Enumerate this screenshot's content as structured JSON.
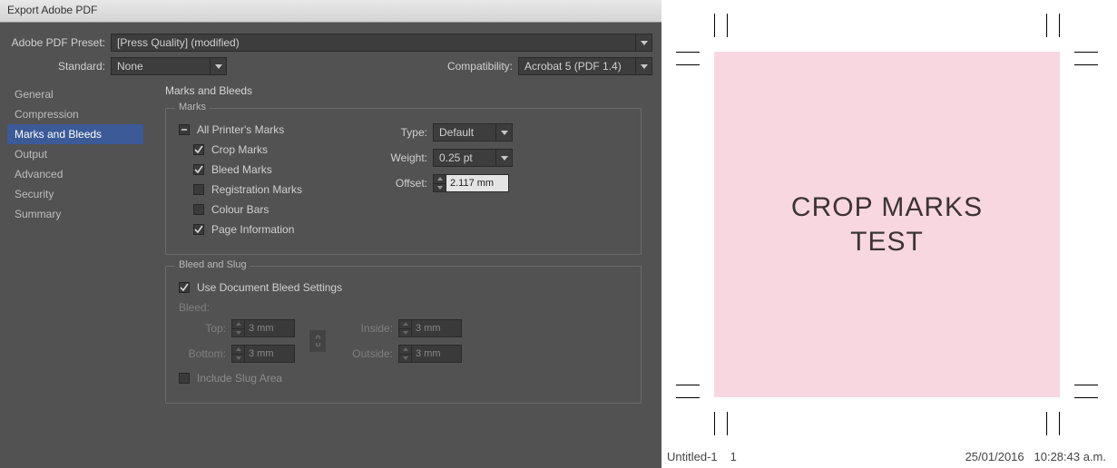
{
  "titlebar": "Export Adobe PDF",
  "preset_label": "Adobe PDF Preset:",
  "preset_value": "[Press Quality] (modified)",
  "standard_label": "Standard:",
  "standard_value": "None",
  "compat_label": "Compatibility:",
  "compat_value": "Acrobat 5 (PDF 1.4)",
  "sidebar": {
    "items": [
      {
        "label": "General"
      },
      {
        "label": "Compression"
      },
      {
        "label": "Marks and Bleeds"
      },
      {
        "label": "Output"
      },
      {
        "label": "Advanced"
      },
      {
        "label": "Security"
      },
      {
        "label": "Summary"
      }
    ]
  },
  "panel_title": "Marks and Bleeds",
  "marks": {
    "legend": "Marks",
    "all": "All Printer's Marks",
    "crop": "Crop Marks",
    "bleed": "Bleed Marks",
    "reg": "Registration Marks",
    "color": "Colour Bars",
    "pageinfo": "Page Information",
    "type_label": "Type:",
    "type_value": "Default",
    "weight_label": "Weight:",
    "weight_value": "0.25 pt",
    "offset_label": "Offset:",
    "offset_value": "2.117 mm"
  },
  "bleed": {
    "legend": "Bleed and Slug",
    "use": "Use Document Bleed Settings",
    "title": "Bleed:",
    "top_label": "Top:",
    "bottom_label": "Bottom:",
    "inside_label": "Inside:",
    "outside_label": "Outside:",
    "top": "3 mm",
    "bottom": "3 mm",
    "inside": "3 mm",
    "outside": "3 mm",
    "slug": "Include Slug Area"
  },
  "preview": {
    "line1": "CROP MARKS",
    "line2": "TEST",
    "doc": "Untitled-1",
    "page": "1",
    "date": "25/01/2016",
    "time": "10:28:43 a.m."
  }
}
